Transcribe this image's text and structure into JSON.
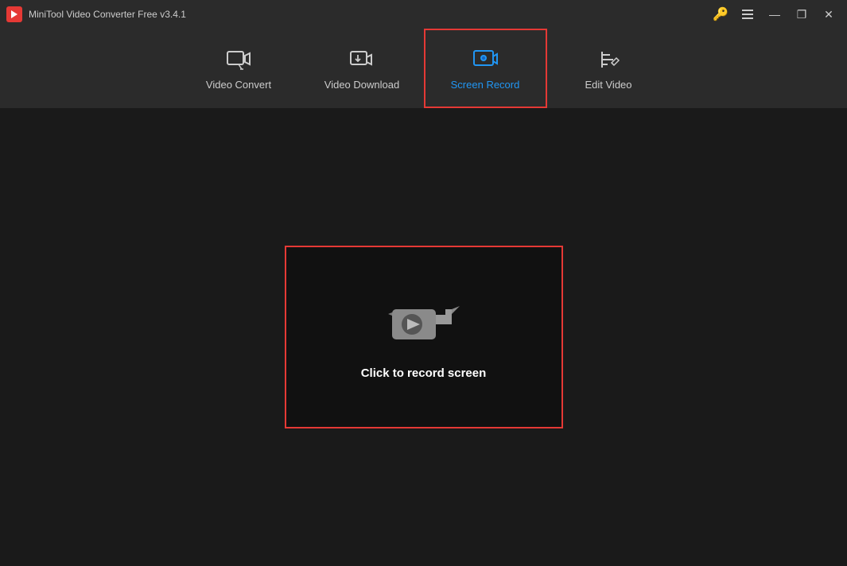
{
  "titleBar": {
    "title": "MiniTool Video Converter Free v3.4.1",
    "controls": {
      "minimize": "—",
      "maximize": "❐",
      "close": "✕"
    }
  },
  "navTabs": [
    {
      "id": "video-convert",
      "label": "Video Convert",
      "active": false
    },
    {
      "id": "video-download",
      "label": "Video Download",
      "active": false
    },
    {
      "id": "screen-record",
      "label": "Screen Record",
      "active": true
    },
    {
      "id": "edit-video",
      "label": "Edit Video",
      "active": false
    }
  ],
  "recordArea": {
    "label": "Click to record screen"
  }
}
